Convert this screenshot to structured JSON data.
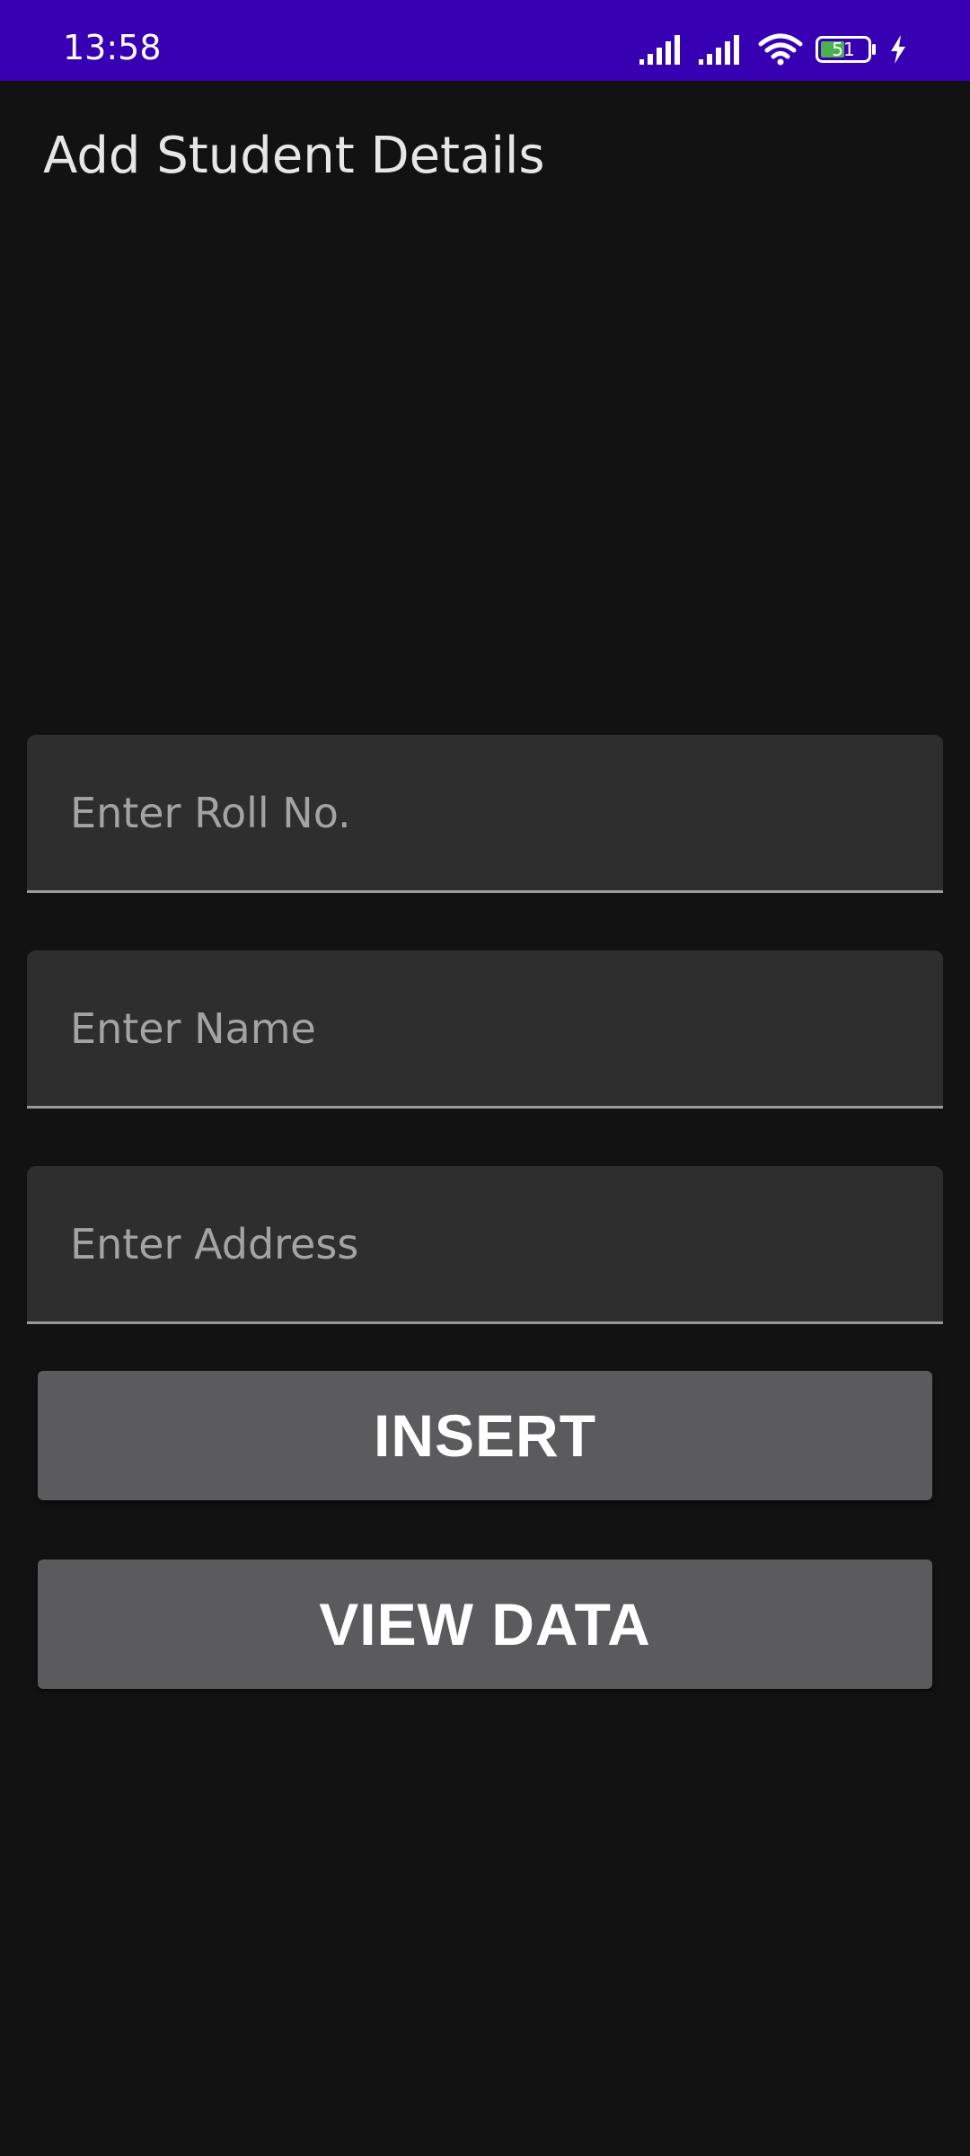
{
  "status_bar": {
    "time": "13:58",
    "battery_level": "51",
    "icons": [
      "signal-icon",
      "signal-icon",
      "wifi-icon",
      "battery-icon",
      "charging-icon"
    ],
    "background_color": "#3700b3"
  },
  "app": {
    "title": "Add Student Details",
    "background_color": "#121212"
  },
  "form": {
    "roll_placeholder": "Enter Roll No.",
    "roll_value": "",
    "name_placeholder": "Enter Name",
    "name_value": "",
    "address_placeholder": "Enter Address",
    "address_value": ""
  },
  "buttons": {
    "insert_label": "INSERT",
    "view_data_label": "VIEW DATA",
    "color": "#5b5b5d"
  }
}
